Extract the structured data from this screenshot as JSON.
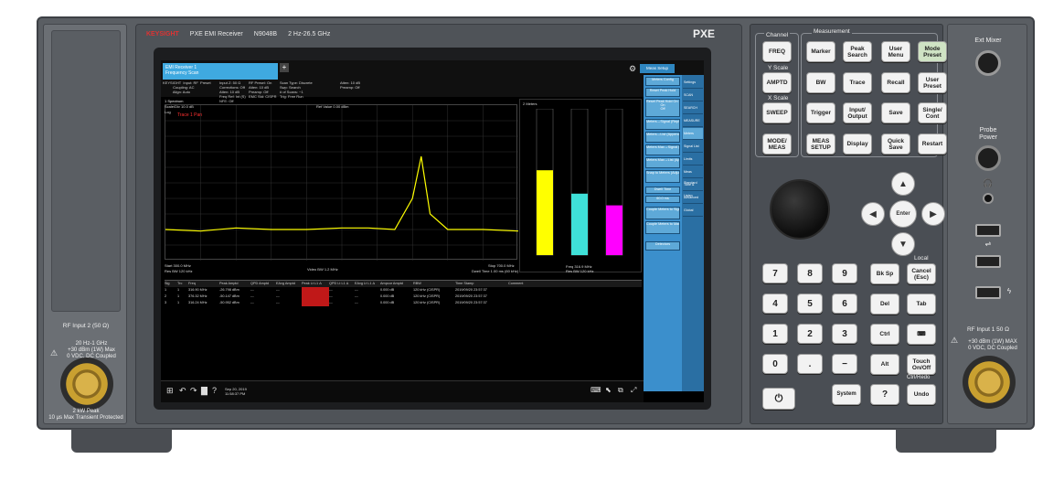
{
  "brand": {
    "logo": "KEYSIGHT",
    "model_title": "PXE EMI Receiver",
    "model_number": "N9048B",
    "freq_range": "2 Hz-26.5 GHz",
    "series": "PXE"
  },
  "left_panel": {
    "rf_input2_label": "RF Input 2 (50 Ω)",
    "rf_input2_spec": "20 Hz-1 GHz\n+30 dBm (1W) Max\n0 VDC, DC Coupled",
    "rf_input2_peak": "2 kW Peak\n10 μs Max Transient Protected"
  },
  "screen": {
    "mode_tab": "EMI Receiver 1\nFrequency Scan",
    "menu_title": "Meas Setup",
    "info_left": "KEYSIGHT  Input: RF  Preset\n          Coupling: AC\n          Align: Auto",
    "info_mid": "Input Z: 50 Ω\nCorrections: Off\nAtten: 10 dB\nFreq Ref: Int (S)\nNFE: Off",
    "info_mid2": "RF Presel: On\nAtten: 10 dB\nPreamp: Off\nEMC Std: CISPR",
    "info_right": "Scan Type: Discrete\nSwp: Search\n# of Scans: ~1\nTrig: Free Run",
    "info_far": "Atten: 10 dB\nPreamp: Off",
    "trace_label": "1 Spectrum",
    "scale_div": "Scale/Div 10.0 dB",
    "ref_value": "Ref Value 0.00 dBm",
    "log_label": "Log",
    "trace_name": "Trace 1 Pan",
    "start_freq": "Start 300.0 MHz",
    "res_bw": "Res BW 120 kHz",
    "video_bw": "Video BW 1.2 MHz",
    "stop_freq": "Stop 700.0 MHz",
    "dwell": "Dwell Time 1.00 ms (60 kHz)",
    "meters_label": "2 Meters",
    "meter_freq": "Freq 316.9 MHz",
    "meter_rbw": "Res BW 120 kHz",
    "table_headers": [
      "Sig",
      "Trc",
      "Freq",
      "Peak Amptd",
      "QPD Amptd",
      "EAvg Amptd",
      "Peak Lt L1 Δ",
      "QPD Lt L1 Δ",
      "EAvg Lt L1 Δ",
      "Ampcor Amptd",
      "RBW",
      "Time Stamp",
      "Comment"
    ],
    "table_rows": [
      [
        "1",
        "1",
        "316.90 MHz",
        "-26.798 dBm",
        "---",
        "---",
        "",
        "---",
        "---",
        "0.000 dB",
        "120 kHz (CISPR)",
        "2019/09/20 23:57:37",
        ""
      ],
      [
        "2",
        "1",
        "376.32 MHz",
        "-50.147 dBm",
        "---",
        "---",
        "",
        "---",
        "---",
        "0.000 dB",
        "120 kHz (CISPR)",
        "2019/09/20 23:57:37",
        ""
      ],
      [
        "3",
        "1",
        "316.24 MHz",
        "-50.952 dBm",
        "---",
        "---",
        "",
        "---",
        "---",
        "0.000 dB",
        "120 kHz (CISPR)",
        "2019/09/20 23:57:37",
        ""
      ]
    ],
    "taskbar_date": "Sep 20, 2019\n11:58:37 PM",
    "menu_buttons": [
      "Meters Config",
      "Reset Peak Hold",
      "Reset Peak Hold On Freq Change\nOn\nOff",
      "Meters→Signal (Replace)",
      "Meters→List (Append)",
      "Meters Max→Signal (Replace)",
      "Meters Max→List (Append)",
      "Snap to Meters (Adjust Center)",
      "Dwell Time",
      "60.0 ms",
      "Couple Meters to Signal List",
      "Couple Meters to Marker",
      "Detectors"
    ],
    "menu_tabs": [
      "Settings",
      "SCAN",
      "SEARCH",
      "MEASURE",
      "Meters",
      "Signal List",
      "Limits",
      "Meas Standard",
      "Tune & Listen",
      "Advanced",
      "Global"
    ]
  },
  "chart_data": {
    "type": "line",
    "title": "",
    "xlim": [
      300,
      700
    ],
    "ylim": [
      -100,
      0
    ],
    "x_unit": "MHz",
    "y_unit": "dBm",
    "series": [
      {
        "x": [
          300,
          340,
          380,
          420,
          460,
          500,
          530,
          560,
          580,
          590,
          600,
          620,
          660,
          700
        ],
        "y": [
          -80,
          -81,
          -79,
          -80,
          -80,
          -79,
          -79,
          -80,
          -60,
          -33,
          -70,
          -80,
          -80,
          -81
        ]
      }
    ],
    "meters": [
      {
        "color": "#ffff00",
        "level": 0.58
      },
      {
        "color": "#3fe0d8",
        "level": 0.42
      },
      {
        "color": "#ff00ff",
        "level": 0.34
      }
    ]
  },
  "right_panel": {
    "channel_label": "Channel",
    "measurement_label": "Measurement",
    "yscale_label": "Y Scale",
    "xscale_label": "X Scale",
    "local_label": "Local",
    "ctrl_redo": "Ctrl/Redo",
    "keys": {
      "freq": "FREQ",
      "marker": "Marker",
      "peak_search": "Peak\nSearch",
      "user_menu": "User\nMenu",
      "mode_preset": "Mode\nPreset",
      "amptd": "AMPTD",
      "bw": "BW",
      "trace": "Trace",
      "recall": "Recall",
      "user_preset": "User\nPreset",
      "sweep": "SWEEP",
      "trigger": "Trigger",
      "input_output": "Input/\nOutput",
      "save": "Save",
      "single_cont": "Single/\nCont",
      "mode_meas": "MODE/\nMEAS",
      "meas_setup": "MEAS\nSETUP",
      "display": "Display",
      "quick_save": "Quick\nSave",
      "restart": "Restart",
      "enter": "Enter",
      "bksp": "Bk Sp",
      "cancel": "Cancel\n(Esc)",
      "del": "Del",
      "tab": "Tab",
      "ctrl": "Ctrl",
      "alt": "Alt",
      "touch": "Touch\nOn/Off",
      "system": "System",
      "help": "?",
      "undo": "Undo"
    },
    "numpad": [
      "7",
      "8",
      "9",
      "4",
      "5",
      "6",
      "1",
      "2",
      "3",
      "0",
      ".",
      "−"
    ]
  },
  "far_right": {
    "ext_mixer": "Ext Mixer",
    "probe_power": "Probe\nPower",
    "rf_input1_label": "RF Input 1 50 Ω",
    "rf_input1_spec": "+30 dBm (1W) MAX\n0 VDC, DC Coupled"
  }
}
